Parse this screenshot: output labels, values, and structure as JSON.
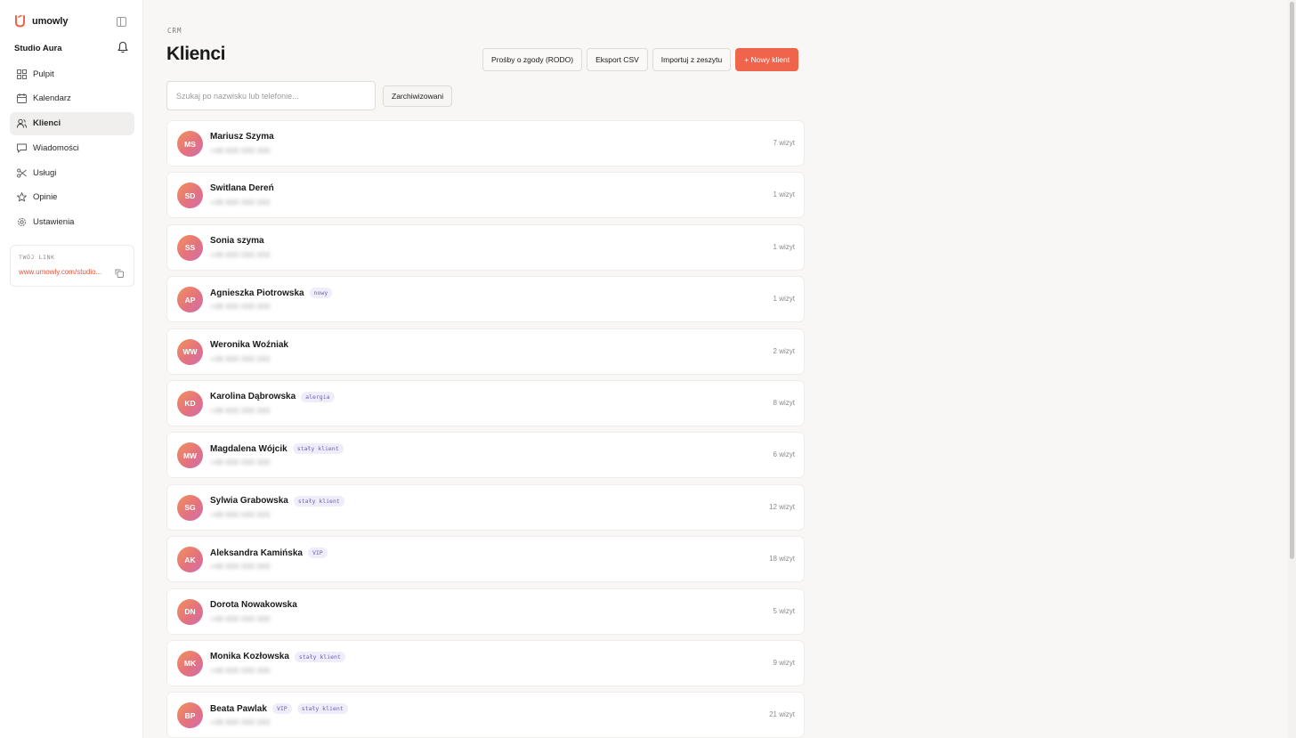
{
  "app": {
    "name": "umowly"
  },
  "sidebar": {
    "studio": "Studio Aura",
    "items": [
      {
        "label": "Pulpit",
        "icon": "grid-icon",
        "active": false
      },
      {
        "label": "Kalendarz",
        "icon": "calendar-icon",
        "active": false
      },
      {
        "label": "Klienci",
        "icon": "users-icon",
        "active": true
      },
      {
        "label": "Wiadomości",
        "icon": "message-icon",
        "active": false
      },
      {
        "label": "Usługi",
        "icon": "scissors-icon",
        "active": false
      },
      {
        "label": "Opinie",
        "icon": "star-icon",
        "active": false
      },
      {
        "label": "Ustawienia",
        "icon": "gear-icon",
        "active": false
      }
    ],
    "link": {
      "label": "TWÓJ LINK",
      "url": "www.umowly.com/studio..."
    }
  },
  "main": {
    "breadcrumb": "CRM",
    "title": "Klienci",
    "actions": {
      "consents": "Prośby o zgody (RODO)",
      "export": "Eksport CSV",
      "import": "Importuj z zeszytu",
      "new_client": "+ Nowy klient"
    },
    "search": {
      "placeholder": "Szukaj po nazwisku lub telefonie..."
    },
    "archived_label": "Zarchiwizowani",
    "clients": [
      {
        "initials": "MS",
        "name": "Mariusz Szyma",
        "tags": [],
        "phone": "+48 600 000 000",
        "visits": "7 wizyt"
      },
      {
        "initials": "SD",
        "name": "Switlana Dereń",
        "tags": [],
        "phone": "+48 600 000 000",
        "visits": "1 wizyt"
      },
      {
        "initials": "SS",
        "name": "Sonia szyma",
        "tags": [],
        "phone": "+48 600 000 000",
        "visits": "1 wizyt"
      },
      {
        "initials": "AP",
        "name": "Agnieszka Piotrowska",
        "tags": [
          "nowy"
        ],
        "phone": "+48 600 000 000",
        "visits": "1 wizyt"
      },
      {
        "initials": "WW",
        "name": "Weronika Woźniak",
        "tags": [],
        "phone": "+48 600 000 000",
        "visits": "2 wizyt"
      },
      {
        "initials": "KD",
        "name": "Karolina Dąbrowska",
        "tags": [
          "alergia"
        ],
        "phone": "+48 600 000 000",
        "visits": "8 wizyt"
      },
      {
        "initials": "MW",
        "name": "Magdalena Wójcik",
        "tags": [
          "stały klient"
        ],
        "phone": "+48 600 000 000",
        "visits": "6 wizyt"
      },
      {
        "initials": "SG",
        "name": "Sylwia Grabowska",
        "tags": [
          "stały klient"
        ],
        "phone": "+48 600 000 000",
        "visits": "12 wizyt"
      },
      {
        "initials": "AK",
        "name": "Aleksandra Kamińska",
        "tags": [
          "VIP"
        ],
        "phone": "+48 600 000 000",
        "visits": "18 wizyt"
      },
      {
        "initials": "DN",
        "name": "Dorota Nowakowska",
        "tags": [],
        "phone": "+48 600 000 000",
        "visits": "5 wizyt"
      },
      {
        "initials": "MK",
        "name": "Monika Kozłowska",
        "tags": [
          "stały klient"
        ],
        "phone": "+48 600 000 000",
        "visits": "9 wizyt"
      },
      {
        "initials": "BP",
        "name": "Beata Pawlak",
        "tags": [
          "VIP",
          "stały klient"
        ],
        "phone": "+48 600 000 000",
        "visits": "21 wizyt"
      }
    ]
  },
  "colors": {
    "accent": "#f0644c",
    "tag_bg": "#efedf9",
    "tag_text": "#6a5fb8"
  }
}
